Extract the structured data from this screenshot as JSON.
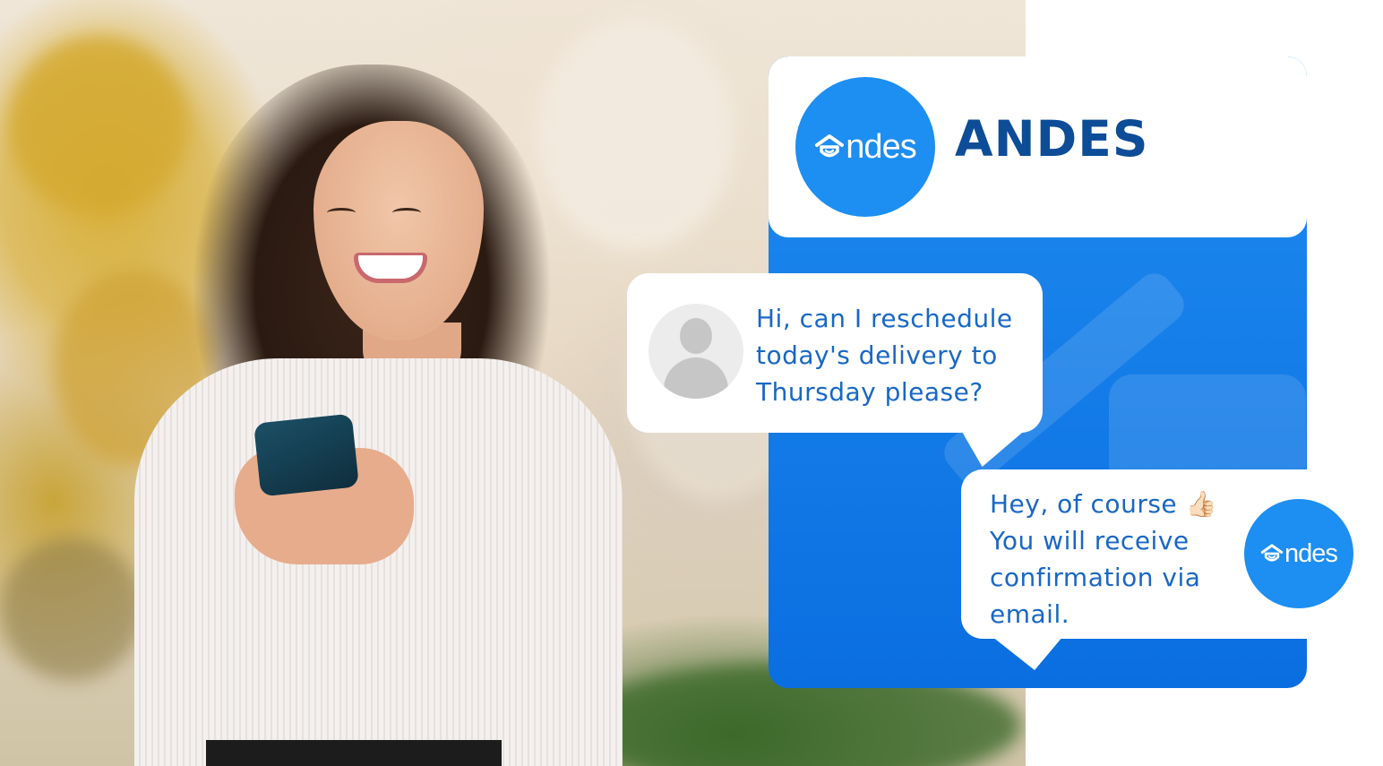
{
  "brand": {
    "logo_text": "ndes",
    "name": "ANDES",
    "primary_color": "#1d8ef2",
    "name_color": "#0d4c97"
  },
  "chat": {
    "user_message": {
      "lines": [
        "Hi, can I reschedule",
        "today's delivery to",
        "Thursday please?"
      ]
    },
    "bot_message": {
      "lines": [
        "Hey, of course 👍🏻",
        "You will receive",
        "confirmation via",
        "email."
      ]
    }
  },
  "icons": {
    "user_avatar": "user-silhouette-icon",
    "logo_house": "house-icon"
  }
}
